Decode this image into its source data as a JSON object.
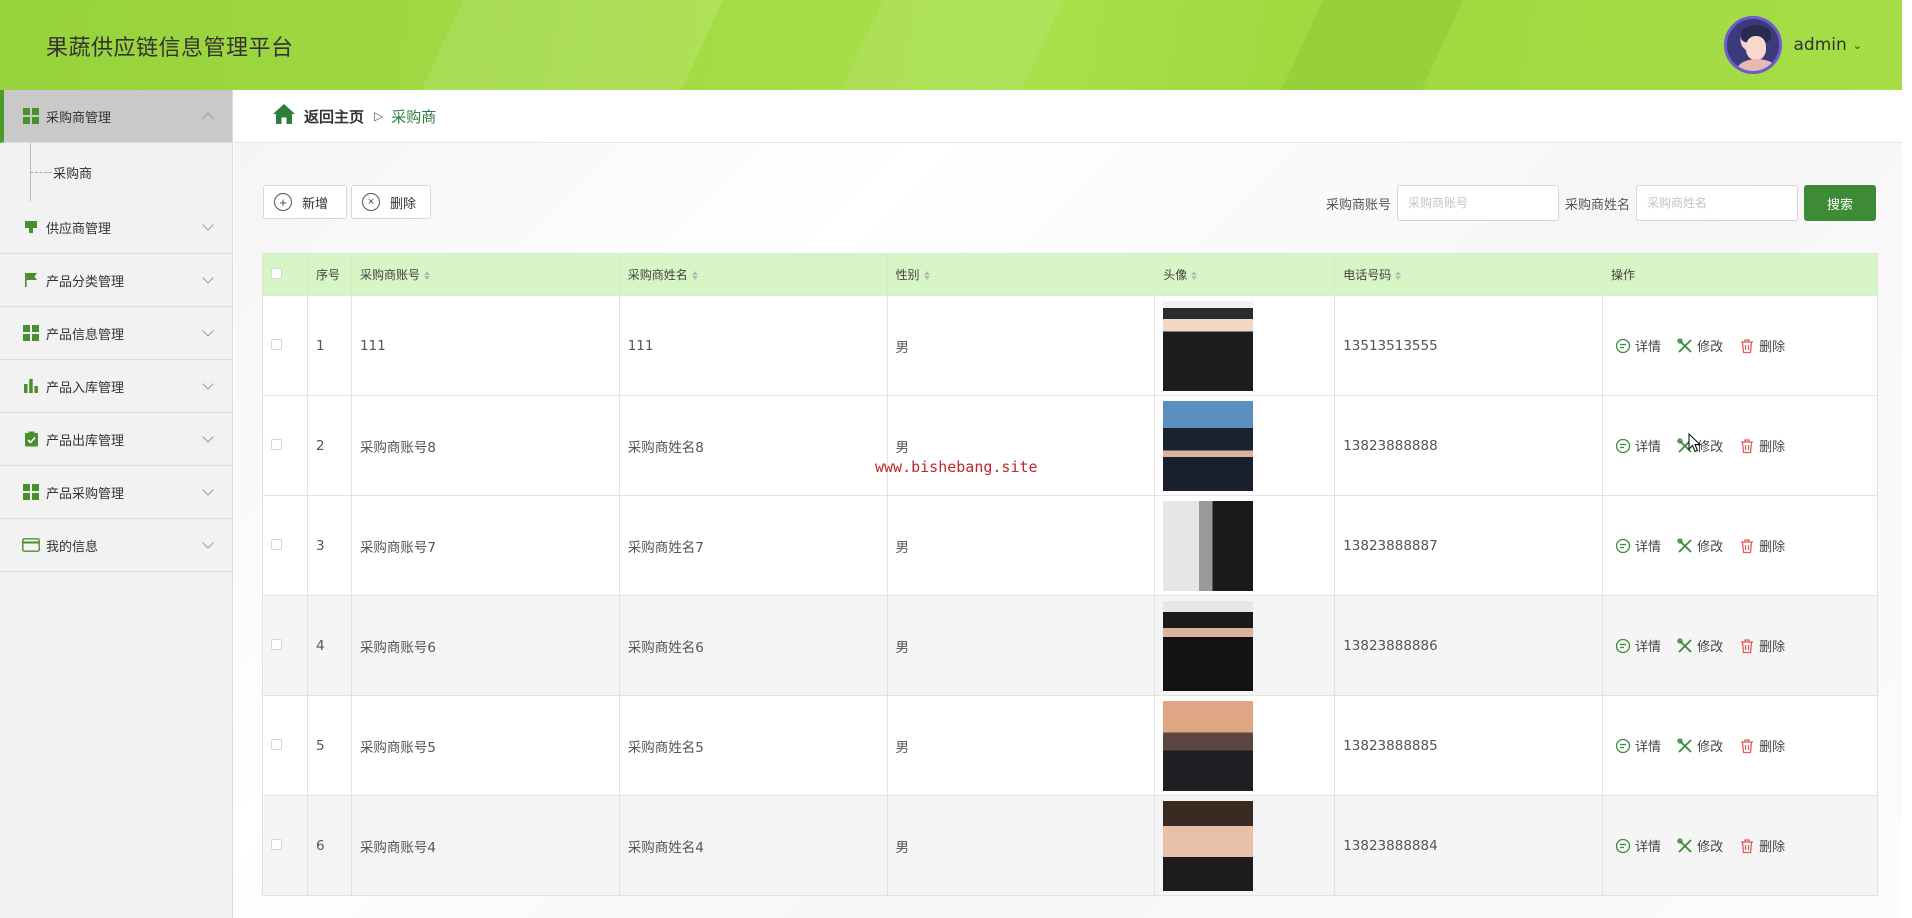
{
  "header": {
    "title": "果蔬供应链信息管理平台",
    "username": "admin"
  },
  "breadcrumb": {
    "home": "返回主页",
    "separator": "▷",
    "current": "采购商"
  },
  "sidebar": {
    "items": [
      {
        "label": "采购商管理",
        "icon": "grid-icon"
      },
      {
        "label": "供应商管理",
        "icon": "stamp-icon"
      },
      {
        "label": "产品分类管理",
        "icon": "flag-icon"
      },
      {
        "label": "产品信息管理",
        "icon": "grid-icon"
      },
      {
        "label": "产品入库管理",
        "icon": "bar-chart-icon"
      },
      {
        "label": "产品出库管理",
        "icon": "clipboard-check-icon"
      },
      {
        "label": "产品采购管理",
        "icon": "grid-icon"
      },
      {
        "label": "我的信息",
        "icon": "card-icon"
      }
    ],
    "submenu": [
      {
        "label": "采购商"
      }
    ]
  },
  "toolbar": {
    "add_label": "新增",
    "delete_label": "删除"
  },
  "search": {
    "account_label": "采购商账号",
    "account_placeholder": "采购商账号",
    "name_label": "采购商姓名",
    "name_placeholder": "采购商姓名",
    "button_label": "搜索"
  },
  "table": {
    "headers": {
      "index": "序号",
      "account": "采购商账号",
      "name": "采购商姓名",
      "gender": "性别",
      "avatar": "头像",
      "phone": "电话号码",
      "actions": "操作"
    },
    "action_labels": {
      "detail": "详情",
      "edit": "修改",
      "delete": "删除"
    },
    "rows": [
      {
        "index": "1",
        "account": "111",
        "name": "111",
        "gender": "男",
        "phone": "13513513555"
      },
      {
        "index": "2",
        "account": "采购商账号8",
        "name": "采购商姓名8",
        "gender": "男",
        "phone": "13823888888"
      },
      {
        "index": "3",
        "account": "采购商账号7",
        "name": "采购商姓名7",
        "gender": "男",
        "phone": "13823888887"
      },
      {
        "index": "4",
        "account": "采购商账号6",
        "name": "采购商姓名6",
        "gender": "男",
        "phone": "13823888886"
      },
      {
        "index": "5",
        "account": "采购商账号5",
        "name": "采购商姓名5",
        "gender": "男",
        "phone": "13823888885"
      },
      {
        "index": "6",
        "account": "采购商账号4",
        "name": "采购商姓名4",
        "gender": "男",
        "phone": "13823888884"
      }
    ]
  },
  "watermark": "www.bishebang.site",
  "colors": {
    "header_green": "#a4dc45",
    "accent_green": "#3d8a37",
    "table_header": "#d7f5c5",
    "danger": "#e05a5a"
  }
}
